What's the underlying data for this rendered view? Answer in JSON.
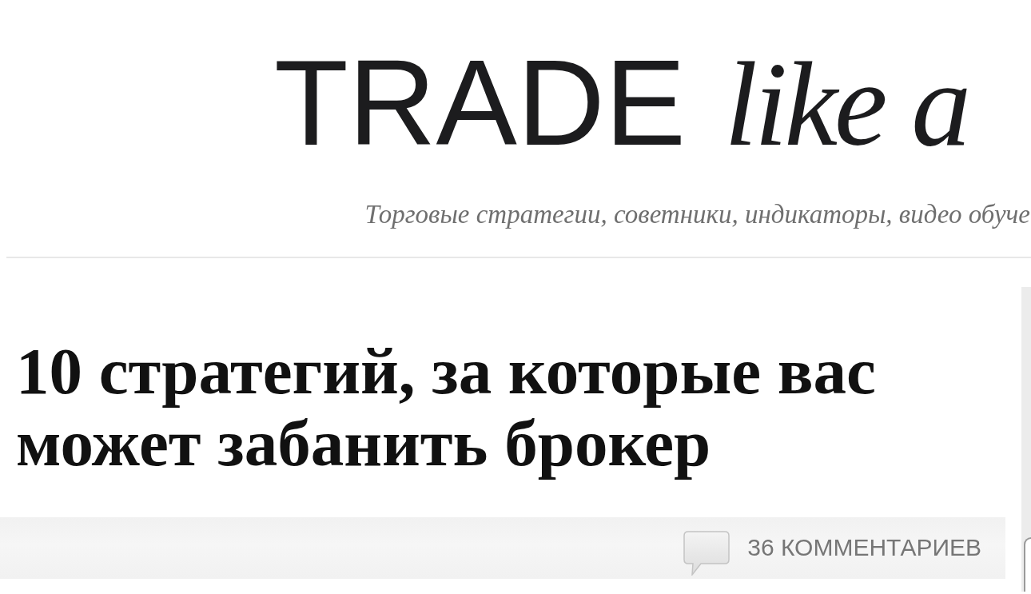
{
  "header": {
    "logo": {
      "word": "TRADE",
      "script": "like a"
    },
    "tagline": "Торговые стратегии, советники, индикаторы, видео обуче"
  },
  "article": {
    "title": "10 стратегий, за которые вас может забанить брокер",
    "comments": {
      "label": "36 КОММЕНТАРИЕВ"
    }
  }
}
